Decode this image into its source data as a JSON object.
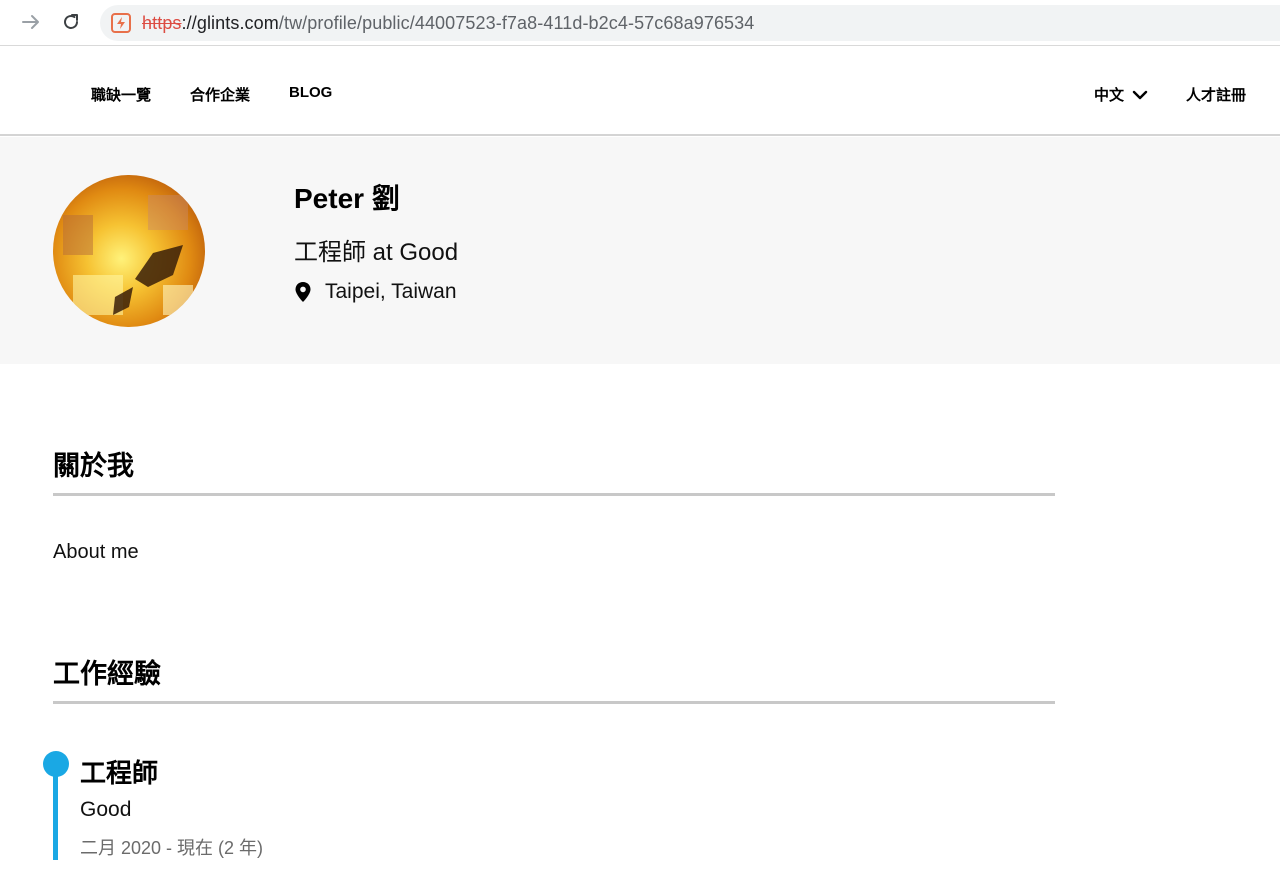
{
  "browser": {
    "url_scheme": "https",
    "url_host": "://glints.com",
    "url_path": "/tw/profile/public/44007523-f7a8-411d-b2c4-57c68a976534"
  },
  "header": {
    "nav": {
      "jobs": "職缺一覽",
      "companies": "合作企業",
      "blog": "BLOG"
    },
    "language": "中文",
    "signup": "人才註冊"
  },
  "profile": {
    "name": "Peter 劉",
    "headline": "工程師 at Good",
    "location": "Taipei, Taiwan"
  },
  "about": {
    "heading": "關於我",
    "text": "About me"
  },
  "experience": {
    "heading": "工作經驗",
    "items": [
      {
        "title": "工程師",
        "company": "Good",
        "dates": "二月 2020 - 現在 (2 年)"
      }
    ]
  },
  "colors": {
    "accent": "#1aa8e4",
    "band_background": "#f7f7f7",
    "insecure_scheme": "#d93025"
  },
  "icons": {
    "forward": "arrow-right-icon",
    "reload": "reload-icon",
    "site_security": "lightning-warning-icon",
    "language_toggle": "chevron-down-icon",
    "location": "map-pin-icon"
  }
}
